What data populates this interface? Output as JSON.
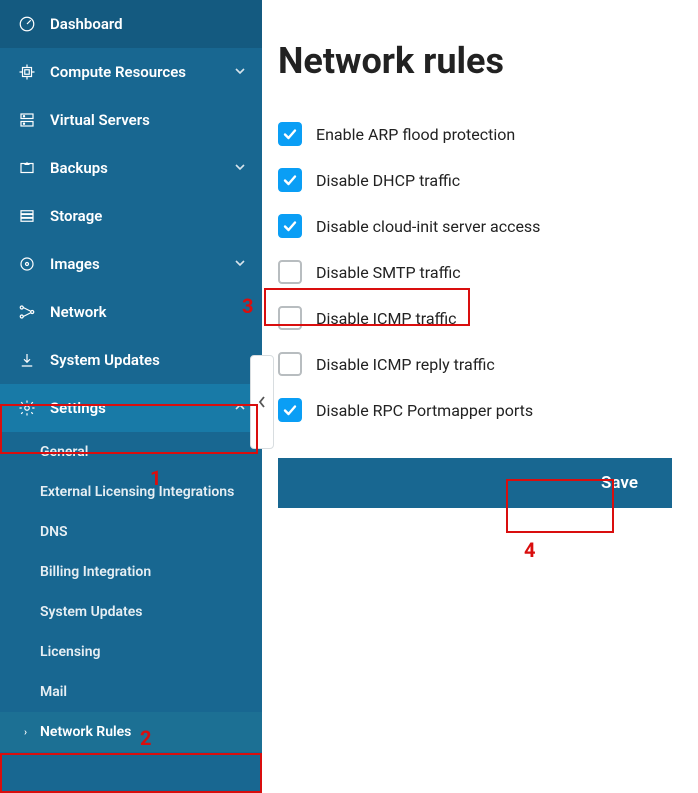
{
  "sidebar": {
    "items": [
      {
        "label": "Dashboard",
        "icon": "gauge"
      },
      {
        "label": "Compute Resources",
        "icon": "cpu",
        "expandable": true
      },
      {
        "label": "Virtual Servers",
        "icon": "servers"
      },
      {
        "label": "Backups",
        "icon": "backup",
        "expandable": true
      },
      {
        "label": "Storage",
        "icon": "storage"
      },
      {
        "label": "Images",
        "icon": "disc",
        "expandable": true
      },
      {
        "label": "Network",
        "icon": "network"
      },
      {
        "label": "System Updates",
        "icon": "download"
      },
      {
        "label": "Settings",
        "icon": "gear",
        "expandable": true,
        "expanded": true,
        "active": true
      }
    ],
    "settings_children": [
      {
        "label": "General"
      },
      {
        "label": "External Licensing Integrations"
      },
      {
        "label": "DNS"
      },
      {
        "label": "Billing Integration"
      },
      {
        "label": "System Updates"
      },
      {
        "label": "Licensing"
      },
      {
        "label": "Mail"
      },
      {
        "label": "Network Rules",
        "active": true
      }
    ]
  },
  "main": {
    "title": "Network rules",
    "rules": [
      {
        "label": "Enable ARP flood protection",
        "checked": true
      },
      {
        "label": "Disable DHCP traffic",
        "checked": true
      },
      {
        "label": "Disable cloud-init server access",
        "checked": true
      },
      {
        "label": "Disable SMTP traffic",
        "checked": false
      },
      {
        "label": "Disable ICMP traffic",
        "checked": false
      },
      {
        "label": "Disable ICMP reply traffic",
        "checked": false
      },
      {
        "label": "Disable RPC Portmapper ports",
        "checked": true
      }
    ],
    "save_label": "Save"
  },
  "annotations": {
    "n1": "1",
    "n2": "2",
    "n3": "3",
    "n4": "4"
  }
}
